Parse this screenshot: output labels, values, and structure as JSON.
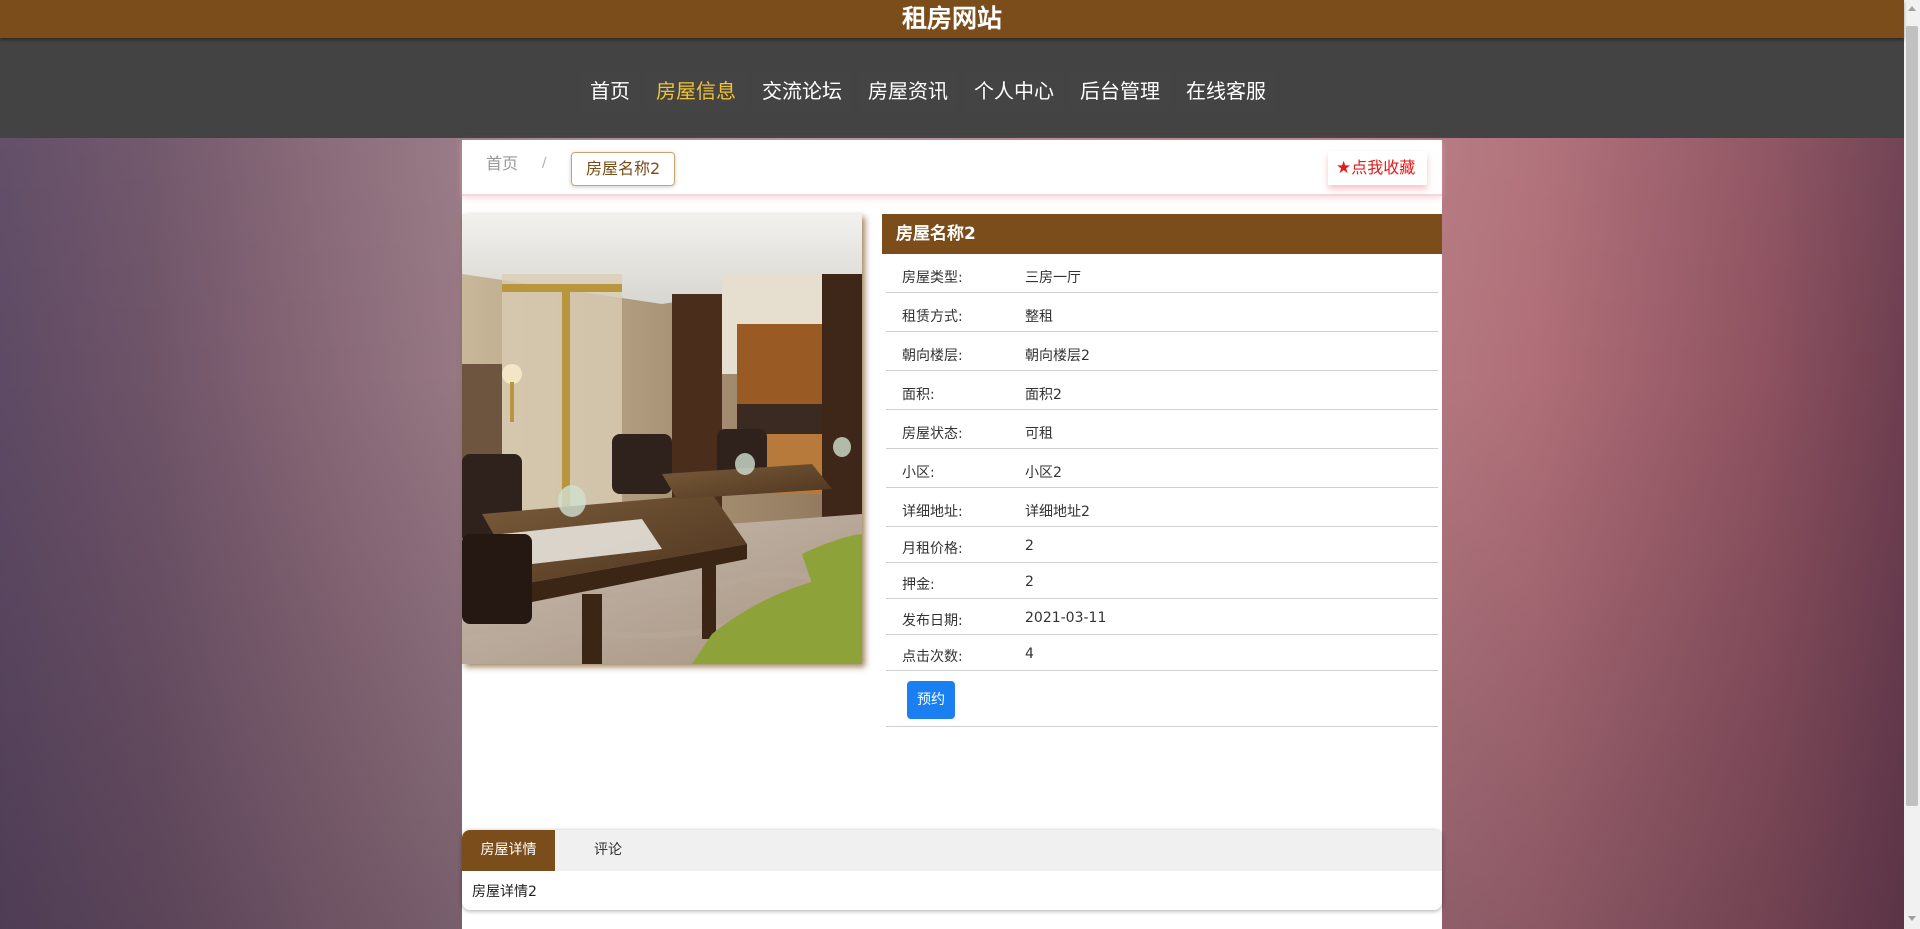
{
  "site": {
    "title": "租房网站"
  },
  "nav": {
    "items": [
      {
        "label": "首页",
        "active": false
      },
      {
        "label": "房屋信息",
        "active": true
      },
      {
        "label": "交流论坛",
        "active": false
      },
      {
        "label": "房屋资讯",
        "active": false
      },
      {
        "label": "个人中心",
        "active": false
      },
      {
        "label": "后台管理",
        "active": false
      },
      {
        "label": "在线客服",
        "active": false
      }
    ],
    "active_color": "#f1c232"
  },
  "breadcrumb": {
    "home": "首页",
    "separator": "/",
    "current": "房屋名称2"
  },
  "favorite": {
    "icon": "star-icon",
    "label": "点我收藏"
  },
  "house": {
    "name": "房屋名称2",
    "fields": [
      {
        "label": "房屋类型:",
        "value": "三房一厅"
      },
      {
        "label": "租赁方式:",
        "value": "整租"
      },
      {
        "label": "朝向楼层:",
        "value": "朝向楼层2"
      },
      {
        "label": "面积:",
        "value": "面积2"
      },
      {
        "label": "房屋状态:",
        "value": "可租"
      },
      {
        "label": "小区:",
        "value": "小区2"
      },
      {
        "label": "详细地址:",
        "value": "详细地址2"
      },
      {
        "label": "月租价格:",
        "value": "2"
      },
      {
        "label": "押金:",
        "value": "2"
      },
      {
        "label": "发布日期:",
        "value": "2021-03-11"
      },
      {
        "label": "点击次数:",
        "value": "4"
      }
    ],
    "book_label": "预约"
  },
  "tabs": {
    "items": [
      {
        "label": "房屋详情",
        "active": true
      },
      {
        "label": "评论",
        "active": false
      }
    ],
    "content": "房屋详情2"
  },
  "colors": {
    "brand": "#7b4d1a",
    "nav_bg": "#434343",
    "button_blue": "#1a7ff0",
    "favorite_red": "#e51a1a"
  }
}
